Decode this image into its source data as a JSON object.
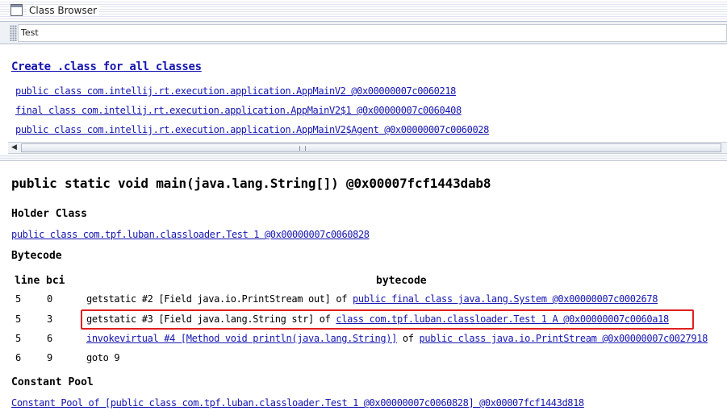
{
  "window": {
    "title": "Class Browser",
    "icon": "window-icon"
  },
  "search": {
    "value": "Test"
  },
  "top_panel": {
    "create_link": "Create .class for all classes",
    "classes": [
      {
        "text": "public class com.intellij.rt.execution.application.AppMainV2 @0x00000007c0060218"
      },
      {
        "text": "final class com.intellij.rt.execution.application.AppMainV2$1 @0x00000007c0060408"
      },
      {
        "text": "public class com.intellij.rt.execution.application.AppMainV2$Agent @0x00000007c0060028"
      }
    ]
  },
  "method": {
    "signature": "public static void main(java.lang.String[]) @0x00007fcf1443dab8",
    "holder_heading": "Holder Class",
    "holder_link": "public class com.tpf.luban.classloader.Test 1 @0x00000007c0060828",
    "bytecode_heading": "Bytecode",
    "columns": {
      "line": "line",
      "bci": "bci",
      "bytecode": "bytecode"
    },
    "rows": [
      {
        "line": "5",
        "bci": "0",
        "prefix": "getstatic #2 [Field java.io.PrintStream out] of ",
        "link": "public final class java.lang.System @0x00000007c0002678",
        "suffix": ""
      },
      {
        "line": "5",
        "bci": "3",
        "prefix": "getstatic #3 [Field java.lang.String str] of ",
        "link": "class com.tpf.luban.classloader.Test 1 A @0x00000007c0060a18",
        "suffix": ""
      },
      {
        "line": "5",
        "bci": "6",
        "prefix": "",
        "link": "invokevirtual #4 [Method void println(java.lang.String)]",
        "suffix": " of ",
        "link2": "public class java.io.PrintStream @0x00000007c0027918"
      },
      {
        "line": "6",
        "bci": "9",
        "prefix": "goto 9",
        "link": "",
        "suffix": ""
      }
    ],
    "constant_pool_heading": "Constant Pool",
    "constant_pool_link": "Constant Pool of [public class com.tpf.luban.classloader.Test 1 @0x00000007c0060828] @0x00007fcf1443d818"
  },
  "colors": {
    "link": "#1515b0",
    "highlight_border": "#e02020"
  }
}
